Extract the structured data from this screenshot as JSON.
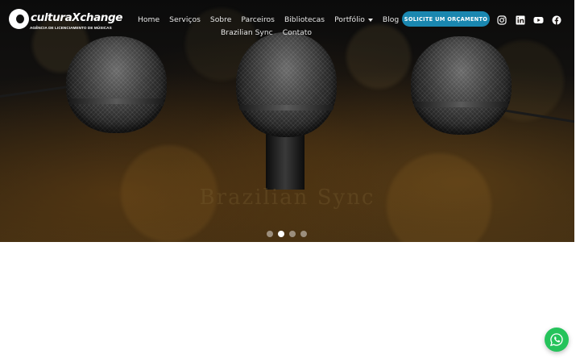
{
  "logo": {
    "name": "culturaXchange",
    "tagline": "AGÊNCIA DE LICENCIAMENTO DE MÚSICAS"
  },
  "nav": {
    "row1": [
      {
        "label": "Home"
      },
      {
        "label": "Serviços"
      },
      {
        "label": "Sobre"
      },
      {
        "label": "Parceiros"
      },
      {
        "label": "Bibliotecas"
      },
      {
        "label": "Portfólio"
      },
      {
        "label": "Blog"
      }
    ],
    "row2": [
      {
        "label": "Brazilian Sync"
      },
      {
        "label": "Contato"
      }
    ]
  },
  "cta": {
    "label": "SOLICITE UM ORÇAMENTO",
    "color": "#1a87b0"
  },
  "social": [
    {
      "icon": "instagram-icon"
    },
    {
      "icon": "linkedin-icon"
    },
    {
      "icon": "youtube-icon"
    },
    {
      "icon": "facebook-icon"
    }
  ],
  "hero": {
    "title": "Brazilian Sync",
    "slides": 4,
    "active_slide": 2
  },
  "whatsapp": {
    "icon": "whatsapp-icon",
    "color": "#25c35b"
  }
}
